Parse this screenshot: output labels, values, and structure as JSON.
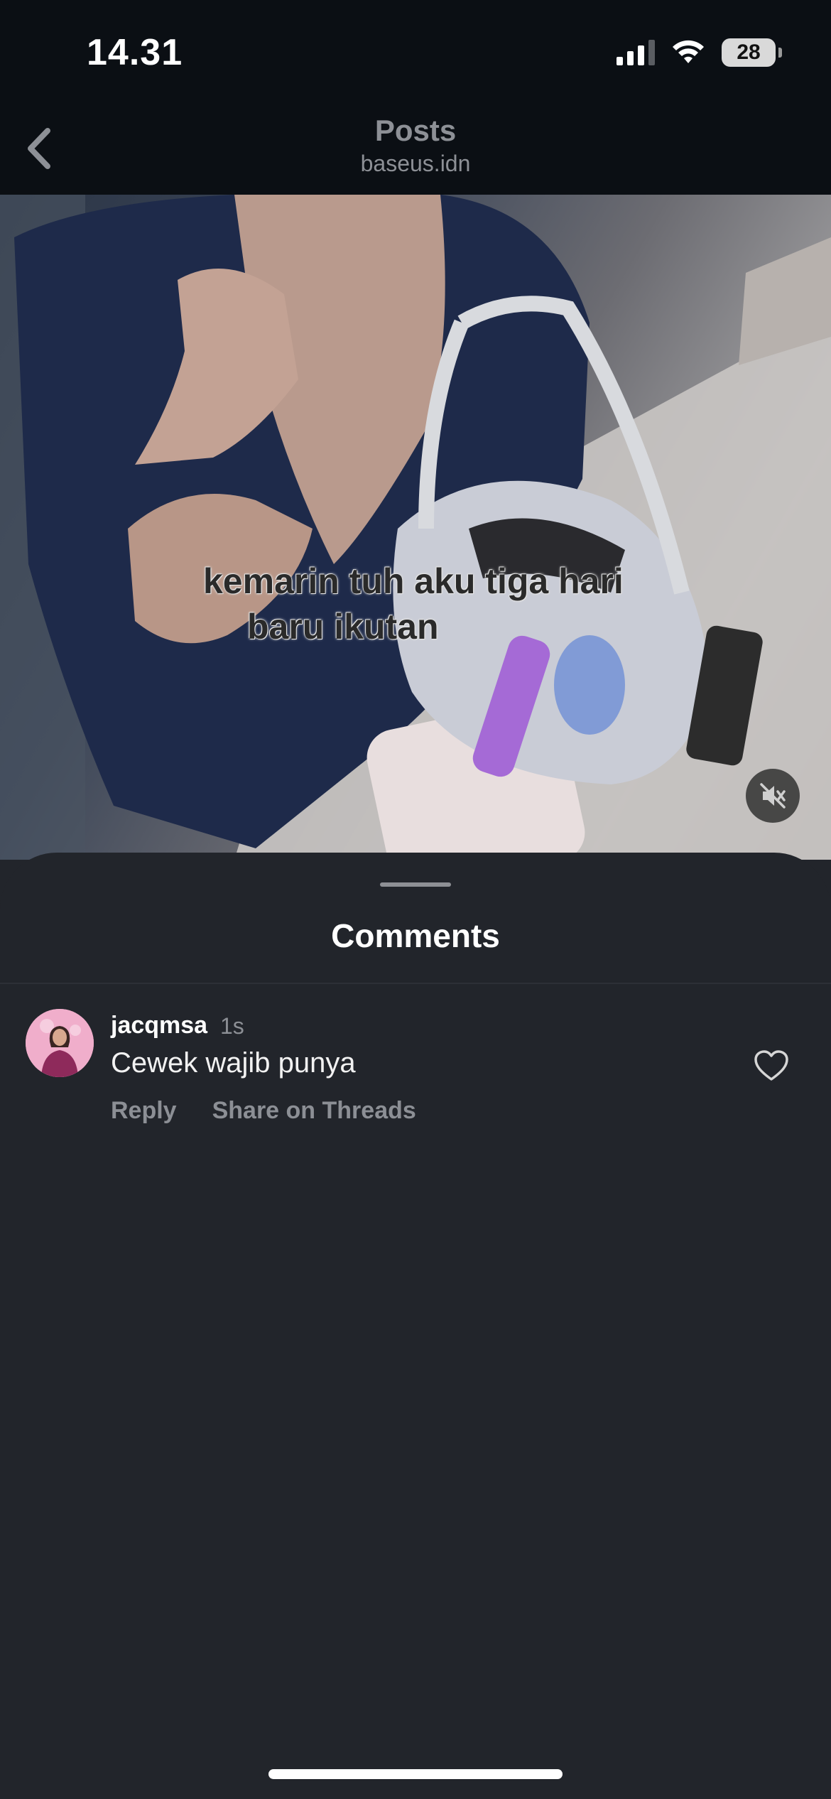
{
  "status_bar": {
    "time": "14.31",
    "battery": "28"
  },
  "header": {
    "title": "Posts",
    "subtitle": "baseus.idn"
  },
  "video": {
    "caption_line1": "kemarin tuh aku tiga hari",
    "caption_line2": "baru ikutan",
    "muted": true
  },
  "comments": {
    "title": "Comments",
    "items": [
      {
        "username": "jacqmsa",
        "time": "1s",
        "text": "Cewek wajib punya",
        "reply_label": "Reply",
        "share_label": "Share on Threads",
        "liked": false
      }
    ]
  },
  "icons": {
    "back": "chevron-left-icon",
    "mute": "speaker-muted-icon",
    "like": "heart-outline-icon",
    "wifi": "wifi-icon",
    "signal": "cellular-signal-icon",
    "battery": "battery-icon"
  },
  "colors": {
    "background": "#22252b",
    "header_background": "#0b0f14",
    "secondary_text": "#8c8f95"
  }
}
